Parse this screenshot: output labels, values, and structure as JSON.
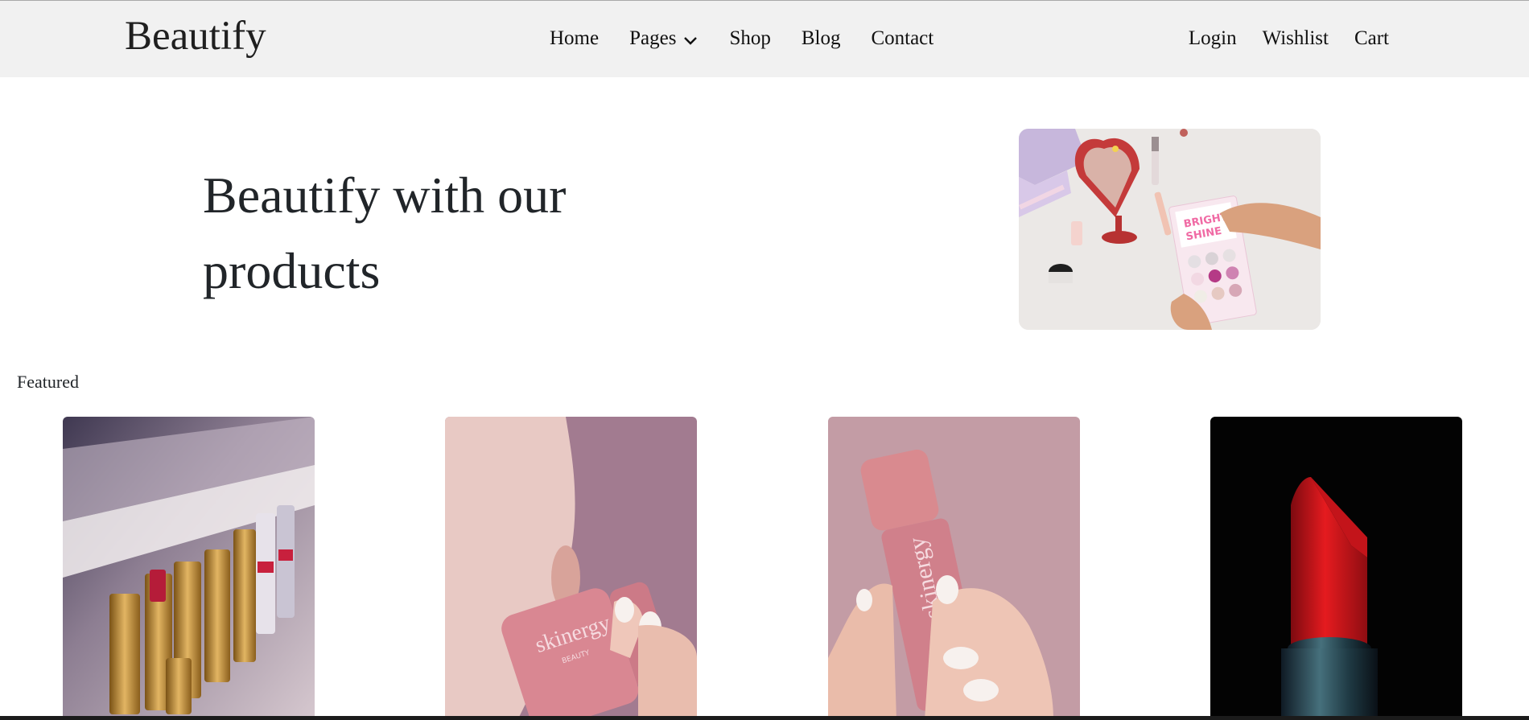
{
  "navbar": {
    "brand": "Beautify",
    "links": [
      "Home",
      "Pages",
      "Shop",
      "Blog",
      "Contact"
    ],
    "right_links": [
      "Login",
      "Wishlist",
      "Cart"
    ],
    "dropdown_icon": "chevron-down-icon"
  },
  "hero": {
    "title": "Beautify with our products",
    "image": "makeup-palette-photo"
  },
  "featured": {
    "label": "Featured",
    "products": [
      {
        "image": "lipstick-row-photo"
      },
      {
        "image": "pink-tube-lips-photo"
      },
      {
        "image": "pink-tube-hand-photo"
      },
      {
        "image": "red-lipstick-photo"
      }
    ]
  },
  "colors": {
    "navbar_bg": "#f1f1f1",
    "text": "#212529"
  }
}
